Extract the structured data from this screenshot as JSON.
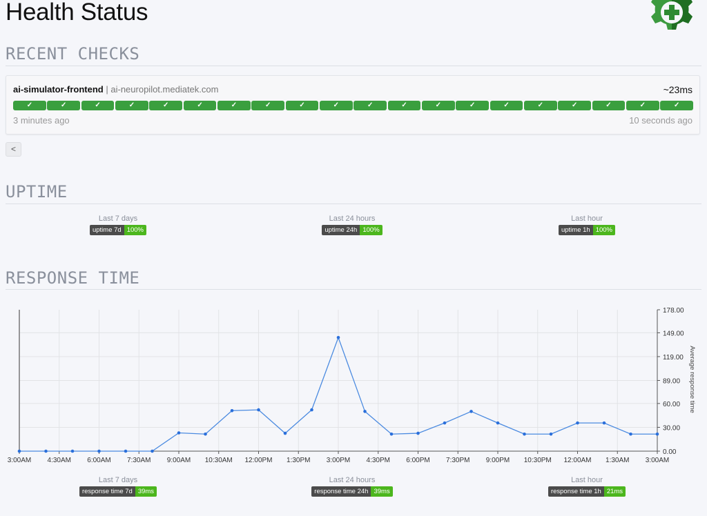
{
  "page": {
    "title": "Health Status",
    "logo_icon": "gear-plus-icon"
  },
  "recent_checks": {
    "section_title": "RECENT CHECKS",
    "service": {
      "name": "ai-simulator-frontend",
      "separator": "|",
      "host": "ai-neuropilot.mediatek.com",
      "latency": "~23ms",
      "checks": [
        "✓",
        "✓",
        "✓",
        "✓",
        "✓",
        "✓",
        "✓",
        "✓",
        "✓",
        "✓",
        "✓",
        "✓",
        "✓",
        "✓",
        "✓",
        "✓",
        "✓",
        "✓",
        "✓",
        "✓"
      ],
      "oldest_label": "3 minutes ago",
      "newest_label": "10 seconds ago",
      "status_color": "#3a9f3e"
    },
    "prev_button": "<"
  },
  "uptime": {
    "section_title": "UPTIME",
    "stats": [
      {
        "label": "Last 7 days",
        "key": "uptime 7d",
        "value": "100%"
      },
      {
        "label": "Last 24 hours",
        "key": "uptime 24h",
        "value": "100%"
      },
      {
        "label": "Last hour",
        "key": "uptime 1h",
        "value": "100%"
      }
    ]
  },
  "response_time": {
    "section_title": "RESPONSE TIME",
    "stats": [
      {
        "label": "Last 7 days",
        "key": "response time 7d",
        "value": "39ms"
      },
      {
        "label": "Last 24 hours",
        "key": "response time 24h",
        "value": "39ms"
      },
      {
        "label": "Last hour",
        "key": "response time 1h",
        "value": "21ms"
      }
    ]
  },
  "chart_data": {
    "type": "line",
    "title": "",
    "xlabel": "",
    "ylabel": "Average response time",
    "y_axis_side": "right",
    "ylim": [
      0,
      178
    ],
    "y_ticks": [
      "0.00",
      "30.00",
      "60.00",
      "89.00",
      "119.00",
      "149.00",
      "178.00"
    ],
    "y_tick_values": [
      0,
      30,
      60,
      89,
      119,
      149,
      178
    ],
    "x_tick_labels": [
      "3:00AM",
      "4:30AM",
      "6:00AM",
      "7:30AM",
      "9:00AM",
      "10:30AM",
      "12:00PM",
      "1:30PM",
      "3:00PM",
      "4:30PM",
      "6:00PM",
      "7:30PM",
      "9:00PM",
      "10:30PM",
      "12:00AM",
      "1:30AM",
      "3:00AM"
    ],
    "x_range_hours": [
      0,
      24
    ],
    "grid": true,
    "line_color": "#2a6fdb",
    "series": [
      {
        "name": "Average response time",
        "x_hours": [
          0,
          1,
          2,
          3,
          4,
          5,
          6,
          7,
          8,
          9,
          10,
          11,
          12,
          13,
          14,
          15,
          16,
          17,
          18,
          19,
          20,
          21,
          22,
          23,
          24
        ],
        "values": [
          0,
          0,
          0,
          0,
          0,
          0,
          23,
          21.5,
          51,
          52,
          22.5,
          52,
          143,
          50,
          21.5,
          22.5,
          35.5,
          50,
          35.5,
          21.5,
          21.5,
          35.5,
          35.5,
          21.5,
          21.5
        ]
      }
    ]
  }
}
